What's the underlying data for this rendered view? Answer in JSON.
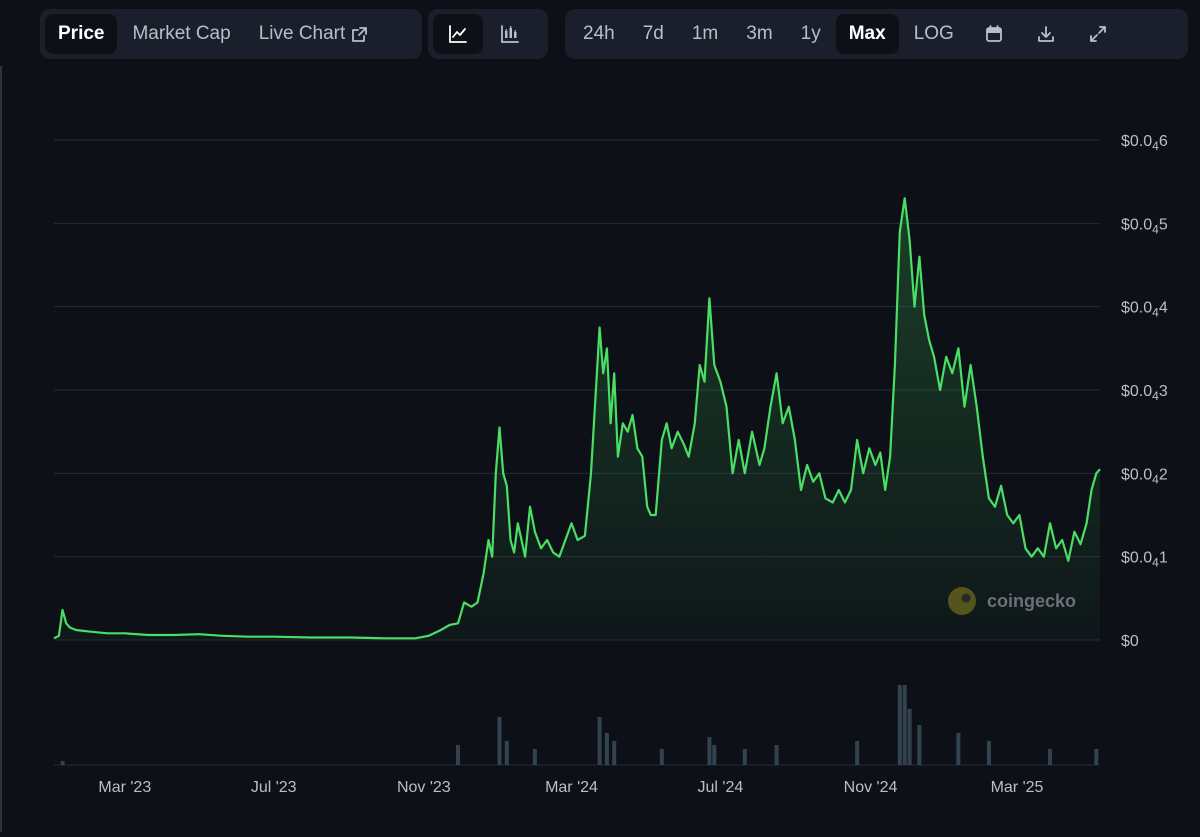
{
  "toolbar": {
    "view_tabs": [
      {
        "label": "Price",
        "active": true
      },
      {
        "label": "Market Cap",
        "active": false
      },
      {
        "label": "Live Chart",
        "active": false,
        "icon": "external-link-icon"
      }
    ],
    "chart_types": [
      {
        "icon": "line-chart-icon",
        "active": true
      },
      {
        "icon": "candlestick-chart-icon",
        "active": false
      }
    ],
    "ranges": [
      {
        "label": "24h",
        "active": false
      },
      {
        "label": "7d",
        "active": false
      },
      {
        "label": "1m",
        "active": false
      },
      {
        "label": "3m",
        "active": false
      },
      {
        "label": "1y",
        "active": false
      },
      {
        "label": "Max",
        "active": true
      },
      {
        "label": "LOG",
        "active": false
      }
    ],
    "tools": [
      {
        "icon": "calendar-icon"
      },
      {
        "icon": "download-icon"
      },
      {
        "icon": "expand-icon"
      }
    ]
  },
  "watermark": "coingecko",
  "colors": {
    "line": "#4ade65",
    "background": "#0d1117",
    "grid": "#232936",
    "volume": "#33424f",
    "axis_text": "#b8bfca"
  },
  "chart_data": {
    "type": "line",
    "title": "",
    "xlabel": "",
    "ylabel": "",
    "x_tick_labels": [
      "Mar '23",
      "Jul '23",
      "Nov '23",
      "Mar '24",
      "Jul '24",
      "Nov '24",
      "Mar '25"
    ],
    "y_tick_labels": [
      {
        "text": "$0",
        "sub": ""
      },
      {
        "prefix": "$0.0",
        "sub": "4",
        "suffix": "1"
      },
      {
        "prefix": "$0.0",
        "sub": "4",
        "suffix": "2"
      },
      {
        "prefix": "$0.0",
        "sub": "4",
        "suffix": "3"
      },
      {
        "prefix": "$0.0",
        "sub": "4",
        "suffix": "4"
      },
      {
        "prefix": "$0.0",
        "sub": "4",
        "suffix": "5"
      },
      {
        "prefix": "$0.0",
        "sub": "4",
        "suffix": "6"
      }
    ],
    "y_unit": "price in units of $0.00001 (0.0₄1)",
    "ylim": [
      0,
      6
    ],
    "xlim": [
      "2023-01-02",
      "2025-05-08"
    ],
    "grid": true,
    "series": [
      {
        "values": [
          [
            "2023-01-02",
            0.02
          ],
          [
            "2023-01-06",
            0.05
          ],
          [
            "2023-01-09",
            0.36
          ],
          [
            "2023-01-12",
            0.2
          ],
          [
            "2023-01-15",
            0.15
          ],
          [
            "2023-01-20",
            0.12
          ],
          [
            "2023-02-01",
            0.1
          ],
          [
            "2023-02-15",
            0.08
          ],
          [
            "2023-03-01",
            0.08
          ],
          [
            "2023-03-20",
            0.06
          ],
          [
            "2023-04-10",
            0.06
          ],
          [
            "2023-05-01",
            0.07
          ],
          [
            "2023-05-20",
            0.05
          ],
          [
            "2023-06-10",
            0.04
          ],
          [
            "2023-07-01",
            0.04
          ],
          [
            "2023-08-01",
            0.03
          ],
          [
            "2023-09-01",
            0.03
          ],
          [
            "2023-10-01",
            0.02
          ],
          [
            "2023-10-25",
            0.02
          ],
          [
            "2023-11-05",
            0.05
          ],
          [
            "2023-11-15",
            0.12
          ],
          [
            "2023-11-22",
            0.18
          ],
          [
            "2023-11-29",
            0.2
          ],
          [
            "2023-12-04",
            0.45
          ],
          [
            "2023-12-10",
            0.4
          ],
          [
            "2023-12-15",
            0.45
          ],
          [
            "2023-12-20",
            0.8
          ],
          [
            "2023-12-24",
            1.2
          ],
          [
            "2023-12-27",
            1.0
          ],
          [
            "2023-12-30",
            2.0
          ],
          [
            "2024-01-02",
            2.55
          ],
          [
            "2024-01-05",
            2.0
          ],
          [
            "2024-01-08",
            1.85
          ],
          [
            "2024-01-11",
            1.2
          ],
          [
            "2024-01-14",
            1.05
          ],
          [
            "2024-01-17",
            1.4
          ],
          [
            "2024-01-20",
            1.2
          ],
          [
            "2024-01-23",
            1.0
          ],
          [
            "2024-01-27",
            1.6
          ],
          [
            "2024-01-31",
            1.3
          ],
          [
            "2024-02-05",
            1.1
          ],
          [
            "2024-02-10",
            1.2
          ],
          [
            "2024-02-15",
            1.05
          ],
          [
            "2024-02-20",
            1.0
          ],
          [
            "2024-02-25",
            1.2
          ],
          [
            "2024-03-01",
            1.4
          ],
          [
            "2024-03-06",
            1.2
          ],
          [
            "2024-03-12",
            1.25
          ],
          [
            "2024-03-17",
            2.0
          ],
          [
            "2024-03-21",
            3.0
          ],
          [
            "2024-03-24",
            3.75
          ],
          [
            "2024-03-27",
            3.2
          ],
          [
            "2024-03-30",
            3.5
          ],
          [
            "2024-04-02",
            2.6
          ],
          [
            "2024-04-05",
            3.2
          ],
          [
            "2024-04-08",
            2.2
          ],
          [
            "2024-04-12",
            2.6
          ],
          [
            "2024-04-16",
            2.5
          ],
          [
            "2024-04-20",
            2.7
          ],
          [
            "2024-04-24",
            2.3
          ],
          [
            "2024-04-28",
            2.2
          ],
          [
            "2024-05-02",
            1.6
          ],
          [
            "2024-05-05",
            1.5
          ],
          [
            "2024-05-09",
            1.5
          ],
          [
            "2024-05-14",
            2.4
          ],
          [
            "2024-05-18",
            2.6
          ],
          [
            "2024-05-22",
            2.3
          ],
          [
            "2024-05-27",
            2.5
          ],
          [
            "2024-06-01",
            2.35
          ],
          [
            "2024-06-05",
            2.2
          ],
          [
            "2024-06-10",
            2.6
          ],
          [
            "2024-06-14",
            3.3
          ],
          [
            "2024-06-18",
            3.1
          ],
          [
            "2024-06-22",
            4.1
          ],
          [
            "2024-06-26",
            3.3
          ],
          [
            "2024-07-01",
            3.1
          ],
          [
            "2024-07-06",
            2.8
          ],
          [
            "2024-07-11",
            2.0
          ],
          [
            "2024-07-16",
            2.4
          ],
          [
            "2024-07-21",
            2.0
          ],
          [
            "2024-07-27",
            2.5
          ],
          [
            "2024-08-02",
            2.1
          ],
          [
            "2024-08-06",
            2.3
          ],
          [
            "2024-08-11",
            2.8
          ],
          [
            "2024-08-16",
            3.2
          ],
          [
            "2024-08-21",
            2.6
          ],
          [
            "2024-08-26",
            2.8
          ],
          [
            "2024-08-31",
            2.4
          ],
          [
            "2024-09-05",
            1.8
          ],
          [
            "2024-09-10",
            2.1
          ],
          [
            "2024-09-15",
            1.9
          ],
          [
            "2024-09-20",
            2.0
          ],
          [
            "2024-09-25",
            1.7
          ],
          [
            "2024-10-01",
            1.65
          ],
          [
            "2024-10-06",
            1.8
          ],
          [
            "2024-10-11",
            1.65
          ],
          [
            "2024-10-16",
            1.8
          ],
          [
            "2024-10-21",
            2.4
          ],
          [
            "2024-10-26",
            2.0
          ],
          [
            "2024-10-31",
            2.3
          ],
          [
            "2024-11-05",
            2.1
          ],
          [
            "2024-11-09",
            2.25
          ],
          [
            "2024-11-13",
            1.8
          ],
          [
            "2024-11-17",
            2.2
          ],
          [
            "2024-11-21",
            3.3
          ],
          [
            "2024-11-25",
            4.9
          ],
          [
            "2024-11-29",
            5.3
          ],
          [
            "2024-12-03",
            4.8
          ],
          [
            "2024-12-07",
            4.0
          ],
          [
            "2024-12-11",
            4.6
          ],
          [
            "2024-12-15",
            3.9
          ],
          [
            "2024-12-19",
            3.6
          ],
          [
            "2024-12-23",
            3.4
          ],
          [
            "2024-12-28",
            3.0
          ],
          [
            "2025-01-02",
            3.4
          ],
          [
            "2025-01-07",
            3.2
          ],
          [
            "2025-01-12",
            3.5
          ],
          [
            "2025-01-17",
            2.8
          ],
          [
            "2025-01-22",
            3.3
          ],
          [
            "2025-01-27",
            2.8
          ],
          [
            "2025-02-01",
            2.2
          ],
          [
            "2025-02-06",
            1.7
          ],
          [
            "2025-02-11",
            1.6
          ],
          [
            "2025-02-16",
            1.85
          ],
          [
            "2025-02-21",
            1.5
          ],
          [
            "2025-02-26",
            1.4
          ],
          [
            "2025-03-03",
            1.5
          ],
          [
            "2025-03-08",
            1.1
          ],
          [
            "2025-03-13",
            1.0
          ],
          [
            "2025-03-18",
            1.1
          ],
          [
            "2025-03-23",
            1.0
          ],
          [
            "2025-03-28",
            1.4
          ],
          [
            "2025-04-02",
            1.1
          ],
          [
            "2025-04-07",
            1.2
          ],
          [
            "2025-04-12",
            0.95
          ],
          [
            "2025-04-17",
            1.3
          ],
          [
            "2025-04-22",
            1.15
          ],
          [
            "2025-04-27",
            1.4
          ],
          [
            "2025-05-01",
            1.8
          ],
          [
            "2025-05-05",
            2.0
          ],
          [
            "2025-05-08",
            2.05
          ]
        ]
      }
    ],
    "volume": {
      "description": "relative volume bars beneath the price chart",
      "values": [
        [
          "2023-01-09",
          0.05
        ],
        [
          "2023-11-29",
          0.25
        ],
        [
          "2024-01-02",
          0.6
        ],
        [
          "2024-01-08",
          0.3
        ],
        [
          "2024-01-31",
          0.2
        ],
        [
          "2024-03-24",
          0.6
        ],
        [
          "2024-03-30",
          0.4
        ],
        [
          "2024-04-05",
          0.3
        ],
        [
          "2024-05-14",
          0.2
        ],
        [
          "2024-06-22",
          0.35
        ],
        [
          "2024-06-26",
          0.25
        ],
        [
          "2024-07-21",
          0.2
        ],
        [
          "2024-08-16",
          0.25
        ],
        [
          "2024-10-21",
          0.3
        ],
        [
          "2024-11-25",
          1.0
        ],
        [
          "2024-11-29",
          1.0
        ],
        [
          "2024-12-03",
          0.7
        ],
        [
          "2024-12-11",
          0.5
        ],
        [
          "2025-01-12",
          0.4
        ],
        [
          "2025-02-06",
          0.3
        ],
        [
          "2025-03-28",
          0.2
        ],
        [
          "2025-05-05",
          0.2
        ]
      ]
    }
  }
}
